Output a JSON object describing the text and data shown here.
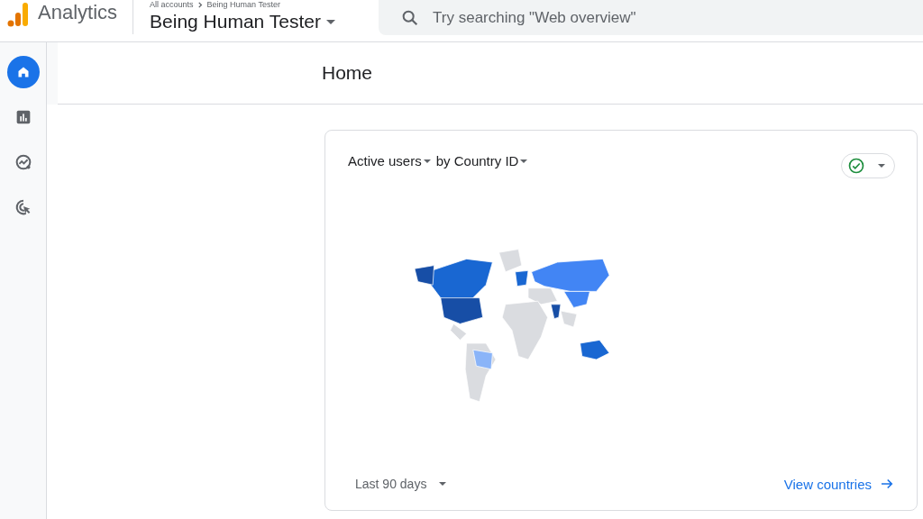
{
  "header": {
    "product": "Analytics",
    "breadcrumb": [
      "All accounts",
      "Being Human Tester"
    ],
    "property": "Being Human Tester",
    "search": {
      "placeholder": "Try searching \"Web overview\""
    }
  },
  "nav": [
    {
      "kind": "home",
      "selected": true
    },
    {
      "kind": "reports",
      "selected": false
    },
    {
      "kind": "explore",
      "selected": false
    },
    {
      "kind": "advertising",
      "selected": false
    }
  ],
  "page": {
    "title": "Home"
  },
  "card": {
    "metric": "Active users",
    "dimension": "by Country ID",
    "status_ok": true,
    "date_range": "Last 90 days",
    "link": "View countries"
  }
}
